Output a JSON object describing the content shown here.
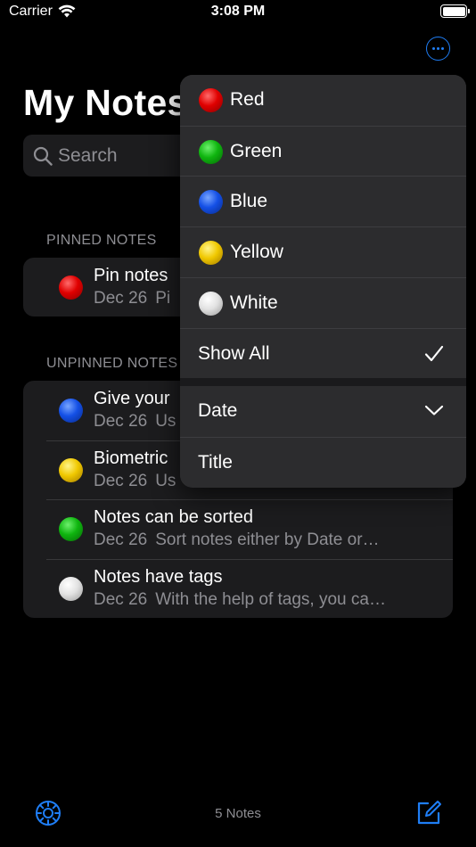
{
  "status": {
    "carrier": "Carrier",
    "time": "3:08 PM"
  },
  "title": "My Notes",
  "search": {
    "placeholder": "Search"
  },
  "pinned": {
    "header": "PINNED NOTES",
    "notes": [
      {
        "title": "Pin notes",
        "date": "Dec 26",
        "preview": "Pi",
        "color": "red"
      }
    ]
  },
  "unpinned": {
    "header": "UNPINNED NOTES",
    "notes": [
      {
        "title": "Give your",
        "date": "Dec 26",
        "preview": "Us",
        "color": "blue"
      },
      {
        "title": "Biometric",
        "date": "Dec 26",
        "preview": "Us",
        "color": "yellow"
      },
      {
        "title": "Notes can be sorted",
        "date": "Dec 26",
        "preview": "Sort notes either by Date or…",
        "color": "green"
      },
      {
        "title": "Notes have tags",
        "date": "Dec 26",
        "preview": "With the help of tags, you ca…",
        "color": "white"
      }
    ]
  },
  "menu": {
    "filters": [
      {
        "label": "Red",
        "color": "red"
      },
      {
        "label": "Green",
        "color": "green"
      },
      {
        "label": "Blue",
        "color": "blue"
      },
      {
        "label": "Yellow",
        "color": "yellow"
      },
      {
        "label": "White",
        "color": "white"
      }
    ],
    "show_all": "Show All",
    "sort": [
      {
        "label": "Date"
      },
      {
        "label": "Title"
      }
    ]
  },
  "toolbar": {
    "count": "5 Notes"
  },
  "colors": {
    "accent": "#1f7ef6",
    "background": "#000000",
    "cell": "#1c1c1e",
    "secondary_text": "#8e8e93"
  }
}
